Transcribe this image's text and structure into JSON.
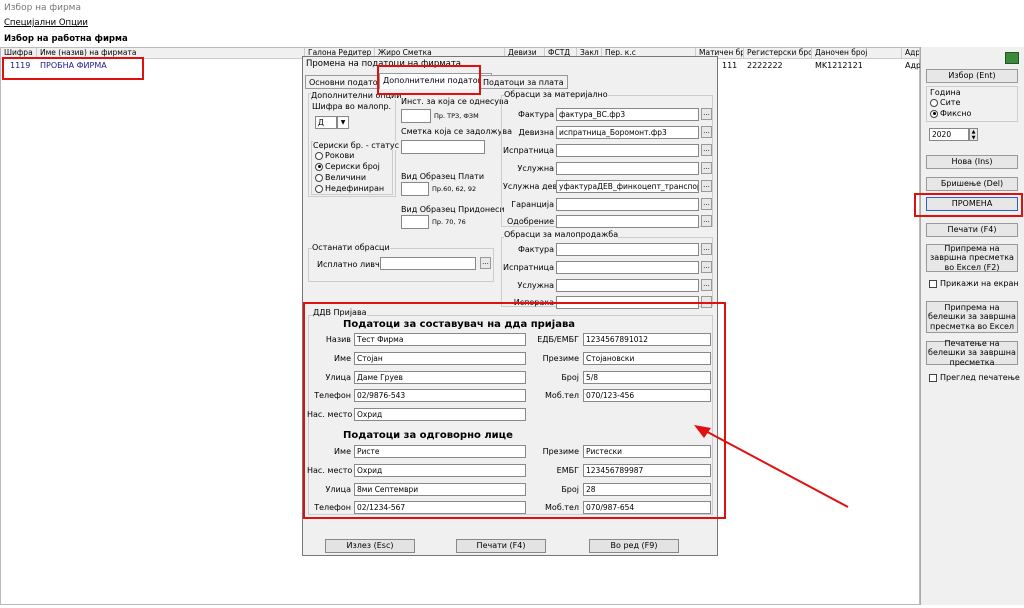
{
  "window_title": "Избор на фирма",
  "menu": {
    "special_options": "Специјални Опции"
  },
  "work_firm_label": "Избор на работна фирма",
  "grid": {
    "headers": [
      "Шифра",
      "Име (назив) на фирмата",
      "Галона Редитер",
      "Жиро Сметка",
      "Девизи",
      "ФСТД",
      "Закл",
      "Пер. к.с",
      "Матичен број",
      "Регистерски број",
      "Даночен број",
      "Адр"
    ],
    "row": {
      "code": "1119",
      "name": "ПРОБНА ФИРМА",
      "matichen": "111",
      "registerski": "2222222",
      "danochen": "MK1212121",
      "adr": "Адр"
    }
  },
  "right_panel": {
    "izbor": "Избор (Ent)",
    "godina_label": "Година",
    "site": "Сите",
    "fiksno": "Фиксно",
    "year": "2020",
    "nova": "Нова (Ins)",
    "brishenje": "Бришење (Del)",
    "promena": "ПРОМЕНА",
    "pechati": "Печати (F4)",
    "priprema_excel": "Припрема на завршна пресметка во Ексел (F2)",
    "prikazhi": "Прикажи на екран",
    "priprema_beleshki": "Припрема на белешки за завршна пресметка во Ексел",
    "pechatenje_beleshki": "Печатење на белешки за завршна пресметка",
    "pregled": "Преглед печатење"
  },
  "dialog": {
    "title": "Промена на податоци на фирмата",
    "tabs": [
      "Основни податоци",
      "Дополнителни податоци",
      "Податоци за плата"
    ],
    "dop_opcii": "Дополнителни опции",
    "shifra_malopr": "Шифра во малопр.",
    "shifra_value": "Д",
    "seriski_status": "Сериски бр. - статус",
    "radio_options": [
      "Рокови",
      "Сериски број",
      "Величини",
      "Недефиниран"
    ],
    "inst_label": "Инст. за која се однесува",
    "inst_hint": "Пр. ТРЗ, ФЗМ",
    "smetka_label": "Сметка која се задолжува",
    "vid_plati": "Вид Образец Плати",
    "vid_plati_hint": "Пр.60, 62, 92",
    "vid_pridonesi": "Вид Образец Придонеси",
    "vid_pridonesi_hint": "Пр. 70, 76",
    "ostanati": "Останати обрасци",
    "isplatno": "Исплатно ливче",
    "obrasci_mat": "Обрасци за материјално",
    "mat_fields": [
      {
        "label": "Фактура",
        "value": "фактура_ВС.фр3"
      },
      {
        "label": "Девизна",
        "value": "испратница_Боромонт.фр3"
      },
      {
        "label": "Испратница",
        "value": ""
      },
      {
        "label": "Услужна",
        "value": ""
      },
      {
        "label": "Услужна дев.",
        "value": "уфактураДЕВ_финкоцепт_транспорт.ф"
      },
      {
        "label": "Гаранција",
        "value": ""
      },
      {
        "label": "Одобрение",
        "value": ""
      }
    ],
    "obrasci_malo": "Обрасци за малопродажба",
    "malo_fields": [
      {
        "label": "Фактура",
        "value": ""
      },
      {
        "label": "Испратница",
        "value": ""
      },
      {
        "label": "Услужна",
        "value": ""
      },
      {
        "label": "Испорака",
        "value": ""
      }
    ],
    "ddv_group": "ДДВ Пријава",
    "sostavuvac_heading": "Податоци за составувач на дда пријава",
    "naziv_label": "Назив",
    "naziv": "Тест Фирма",
    "edb_label": "ЕДБ/ЕМБГ",
    "edb": "1234567891012",
    "ime_label": "Име",
    "ime": "Стојан",
    "prezime_label": "Презиме",
    "prezime": "Стојановски",
    "ulica_label": "Улица",
    "ulica": "Даме Груев",
    "broj_label": "Број",
    "broj": "5/8",
    "telefon_label": "Телефон",
    "telefon": "02/9876-543",
    "mob_label": "Моб.тел",
    "mob": "070/123-456",
    "mesto_label": "Нас. место",
    "mesto": "Охрид",
    "odgovorno_heading": "Податоци за одговорно лице",
    "ime2": "Ристе",
    "prezime2": "Ристески",
    "mesto2": "Охрид",
    "emb_label": "ЕМБГ",
    "emb2": "123456789987",
    "ulica2": "8ми Септември",
    "broj2": "28",
    "telefon2": "02/1234-567",
    "mob2": "070/987-654",
    "izlez": "Излез (Esc)",
    "pechati": "Печати (F4)",
    "vo_red": "Во ред (F9)"
  },
  "colors": {
    "highlight": "#e01010",
    "selected_text": "#1a1a8c"
  }
}
